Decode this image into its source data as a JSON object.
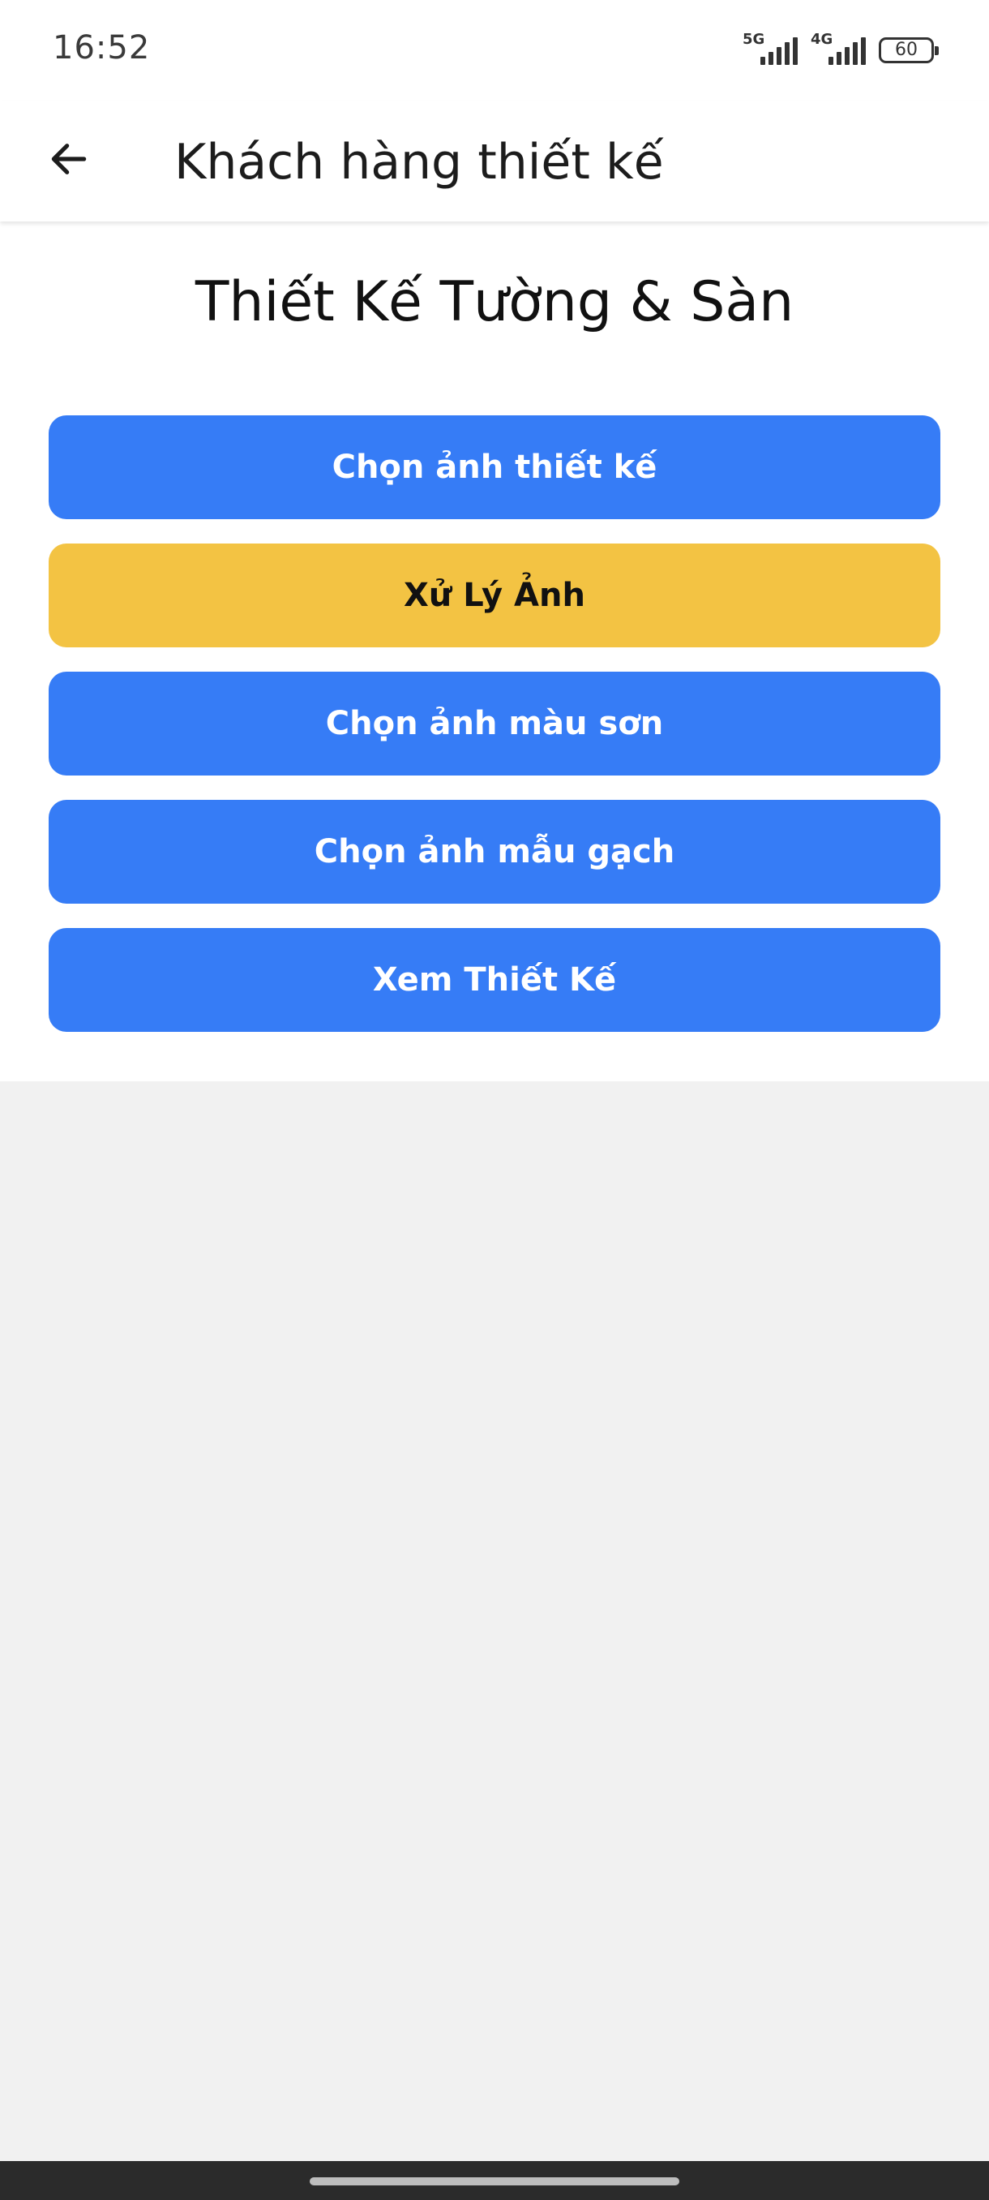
{
  "status_bar": {
    "time": "16:52",
    "network_1": "5G",
    "network_2": "4G",
    "battery": "60"
  },
  "app_bar": {
    "back_icon": "arrow-left-icon",
    "title": "Khách hàng thiết kế"
  },
  "main": {
    "heading": "Thiết Kế Tường & Sàn",
    "buttons": [
      {
        "label": "Chọn ảnh thiết kế",
        "color": "#367cf6"
      },
      {
        "label": "Xử Lý Ảnh",
        "color": "#f3c343"
      },
      {
        "label": "Chọn ảnh màu sơn",
        "color": "#367cf6"
      },
      {
        "label": "Chọn ảnh mẫu gạch",
        "color": "#367cf6"
      },
      {
        "label": "Xem Thiết Kế",
        "color": "#367cf6"
      }
    ]
  },
  "colors": {
    "primary": "#367cf6",
    "accent": "#f3c343",
    "background": "#f1f1f1",
    "surface": "#ffffff"
  }
}
